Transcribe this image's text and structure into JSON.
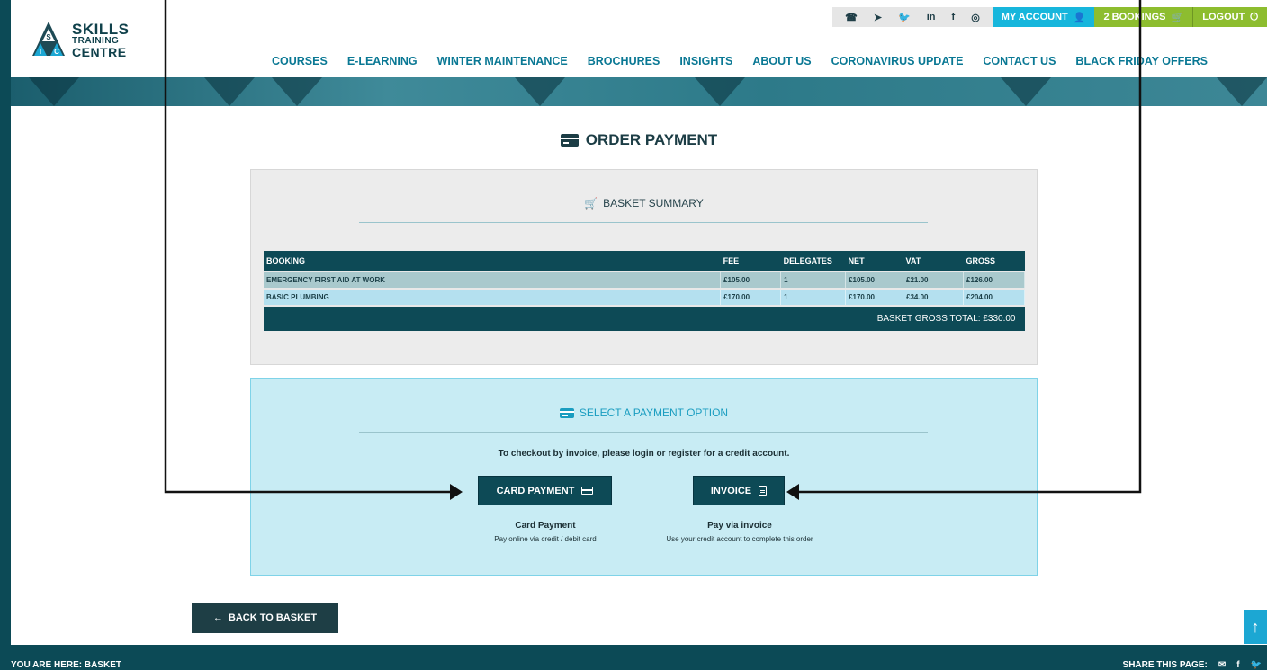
{
  "logo": {
    "line1": "SKILLS",
    "line2": "TRAINING",
    "line3": "CENTRE",
    "letters": [
      "S",
      "T",
      "C"
    ]
  },
  "topbar": {
    "social_icons": [
      "phone-icon",
      "send-icon",
      "twitter-icon",
      "linkedin-icon",
      "facebook-icon",
      "instagram-icon"
    ],
    "my_account": "MY ACCOUNT",
    "bookings": "2 BOOKINGS",
    "logout": "LOGOUT"
  },
  "nav": {
    "items": [
      "COURSES",
      "E-LEARNING",
      "WINTER MAINTENANCE",
      "BROCHURES",
      "INSIGHTS",
      "ABOUT US",
      "CORONAVIRUS UPDATE",
      "CONTACT US",
      "BLACK FRIDAY OFFERS"
    ]
  },
  "order": {
    "title": "ORDER PAYMENT"
  },
  "basket": {
    "heading": "BASKET SUMMARY",
    "columns": [
      "BOOKING",
      "FEE",
      "DELEGATES",
      "NET",
      "VAT",
      "GROSS"
    ],
    "rows": [
      {
        "booking": "EMERGENCY FIRST AID AT WORK",
        "fee": "£105.00",
        "delegates": "1",
        "net": "£105.00",
        "vat": "£21.00",
        "gross": "£126.00"
      },
      {
        "booking": "BASIC PLUMBING",
        "fee": "£170.00",
        "delegates": "1",
        "net": "£170.00",
        "vat": "£34.00",
        "gross": "£204.00"
      }
    ],
    "total_label": "BASKET GROSS TOTAL:",
    "total_value": "£330.00"
  },
  "payment": {
    "heading": "SELECT A PAYMENT OPTION",
    "note": "To checkout by invoice, please login or register for a credit account.",
    "card_button": "CARD PAYMENT",
    "invoice_button": "INVOICE",
    "card_title": "Card Payment",
    "card_desc": "Pay online via credit / debit card",
    "invoice_title": "Pay via invoice",
    "invoice_desc": "Use your credit account to complete this order"
  },
  "back_button": "BACK TO BASKET",
  "footer": {
    "breadcrumb": "YOU ARE HERE: BASKET",
    "share_label": "SHARE THIS PAGE:"
  },
  "colors": {
    "brand_dark": "#0c4a56",
    "accent": "#17b6dc",
    "green": "#8dbd2f",
    "nav_text": "#0a7894"
  }
}
